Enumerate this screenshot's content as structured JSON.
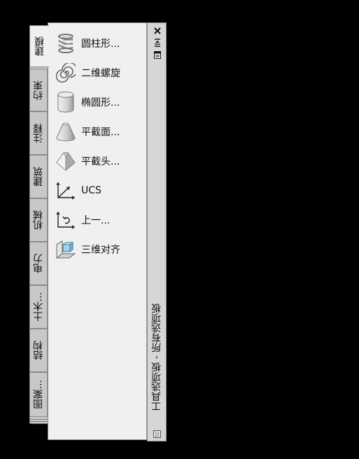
{
  "palette": {
    "title": "工具选项板 - 所有选项板",
    "tabs": [
      {
        "label": "建模",
        "active": true
      },
      {
        "label": "约束"
      },
      {
        "label": "注释"
      },
      {
        "label": "建筑"
      },
      {
        "label": "机械"
      },
      {
        "label": "电力"
      },
      {
        "label": "土木..."
      },
      {
        "label": "结构"
      },
      {
        "label": "图案..."
      }
    ],
    "tools": [
      {
        "label": "圆柱形...",
        "icon": "helix-spring-icon"
      },
      {
        "label": "二维螺旋",
        "icon": "spiral-icon"
      },
      {
        "label": "椭圆形...",
        "icon": "elliptical-cylinder-icon"
      },
      {
        "label": "平截面...",
        "icon": "cone-icon"
      },
      {
        "label": "平截头...",
        "icon": "pyramid-icon"
      },
      {
        "label": "UCS",
        "icon": "ucs-axes-icon"
      },
      {
        "label": "上一...",
        "icon": "ucs-previous-icon"
      },
      {
        "label": "三维对齐",
        "icon": "3d-align-icon"
      }
    ],
    "titlebar_buttons": [
      "close-icon",
      "auto-hide-icon",
      "properties-icon"
    ]
  }
}
